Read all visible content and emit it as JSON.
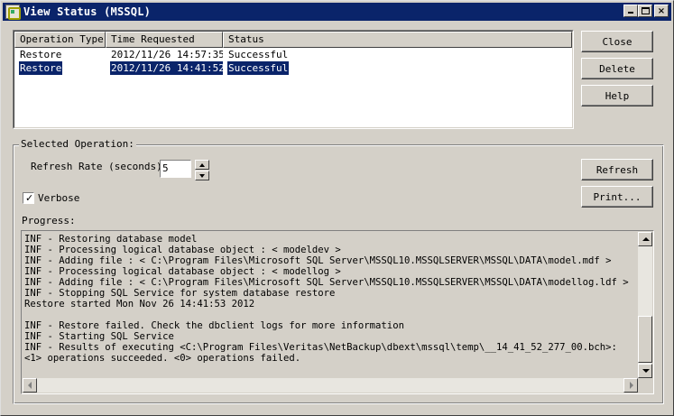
{
  "window": {
    "title": "View Status (MSSQL)",
    "icon": "netbackup-app-icon"
  },
  "titlebar_buttons": {
    "close_glyph": "×"
  },
  "table": {
    "columns": [
      "Operation Type",
      "Time Requested",
      "Status"
    ],
    "rows": [
      {
        "type": "Restore",
        "time": "2012/11/26 14:57:35",
        "status": "Successful",
        "selected": false
      },
      {
        "type": "Restore",
        "time": "2012/11/26 14:41:52",
        "status": "Successful",
        "selected": true
      }
    ]
  },
  "buttons": {
    "close": "Close",
    "delete": "Delete",
    "help": "Help",
    "refresh": "Refresh",
    "print": "Print..."
  },
  "selected_operation": {
    "group_label": "Selected Operation:",
    "refresh_rate_label": "Refresh Rate (seconds):",
    "refresh_rate_value": "5",
    "verbose_label": "Verbose",
    "verbose_checked": true,
    "progress_label": "Progress:"
  },
  "progress_lines": [
    "INF - Restoring database model",
    "INF - Processing logical database object : < modeldev >",
    "INF - Adding file : < C:\\Program Files\\Microsoft SQL Server\\MSSQL10.MSSQLSERVER\\MSSQL\\DATA\\model.mdf >",
    "INF - Processing logical database object : < modellog >",
    "INF - Adding file : < C:\\Program Files\\Microsoft SQL Server\\MSSQL10.MSSQLSERVER\\MSSQL\\DATA\\modellog.ldf >",
    "INF - Stopping SQL Service for system database restore",
    "Restore started Mon Nov 26 14:41:53 2012",
    "",
    "INF - Restore failed. Check the dbclient logs for more information",
    "INF - Starting SQL Service",
    "INF - Results of executing <C:\\Program Files\\Veritas\\NetBackup\\dbext\\mssql\\temp\\__14_41_52_277_00.bch>:",
    "<1> operations succeeded. <0> operations failed."
  ],
  "colors": {
    "titlebar": "#0a246a",
    "selection": "#0a246a",
    "face": "#d4d0c8"
  }
}
